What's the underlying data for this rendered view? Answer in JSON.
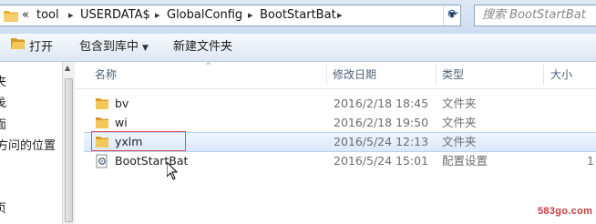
{
  "address": {
    "crumbs": [
      "«",
      "tool",
      "USERDATA$",
      "GlobalConfig",
      "BootStartBat"
    ],
    "search_placeholder": "搜索 BootStartBat"
  },
  "toolbar": {
    "open_label": "打开",
    "include_label": "包含到库中",
    "new_folder_label": "新建文件夹"
  },
  "nav": {
    "items": [
      "夹",
      "戋",
      "面",
      "方问的位置",
      "页"
    ]
  },
  "columns": {
    "name": "名称",
    "modified": "修改日期",
    "type": "类型",
    "size": "大小"
  },
  "files": [
    {
      "name": "bv",
      "modified": "2016/2/18 18:45",
      "type": "文件夹",
      "size": "",
      "icon": "folder-icon"
    },
    {
      "name": "wi",
      "modified": "2016/2/18 19:50",
      "type": "文件夹",
      "size": "",
      "icon": "folder-icon"
    },
    {
      "name": "yxlm",
      "modified": "2016/5/24 12:13",
      "type": "文件夹",
      "size": "",
      "icon": "folder-icon",
      "selected": true
    },
    {
      "name": "BootStartBat",
      "modified": "2016/5/24 15:01",
      "type": "配置设置",
      "size": "1",
      "icon": "config-file-icon"
    }
  ],
  "watermark": "583go.com",
  "colors": {
    "folder": "#e8b23a",
    "selection": "#dbe8f9",
    "rename_outline": "#e05050",
    "watermark": "#c83c3c"
  }
}
